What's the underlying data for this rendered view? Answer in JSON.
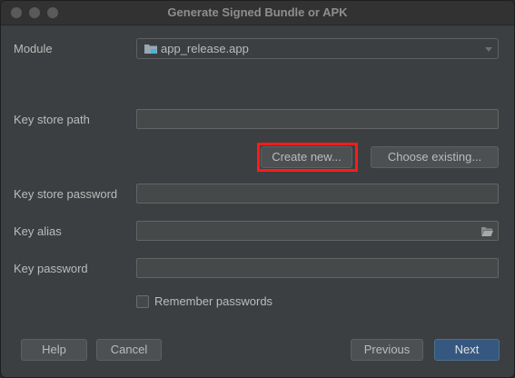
{
  "window": {
    "title": "Generate Signed Bundle or APK"
  },
  "module": {
    "label": "Module",
    "selected": "app_release.app",
    "icon": "module-folder-icon"
  },
  "key_store_path": {
    "label": "Key store path",
    "value": ""
  },
  "key_store_buttons": {
    "create_new": "Create new...",
    "choose_existing": "Choose existing..."
  },
  "key_store_password": {
    "label": "Key store password",
    "value": ""
  },
  "key_alias": {
    "label": "Key alias",
    "value": "",
    "browse_icon": "folder-open-icon"
  },
  "key_password": {
    "label": "Key password",
    "value": ""
  },
  "remember": {
    "label": "Remember passwords",
    "checked": false
  },
  "footer": {
    "help": "Help",
    "cancel": "Cancel",
    "previous": "Previous",
    "next": "Next"
  },
  "colors": {
    "background": "#3c3f41",
    "primary_button": "#365880",
    "highlight": "#ff1a1a"
  }
}
